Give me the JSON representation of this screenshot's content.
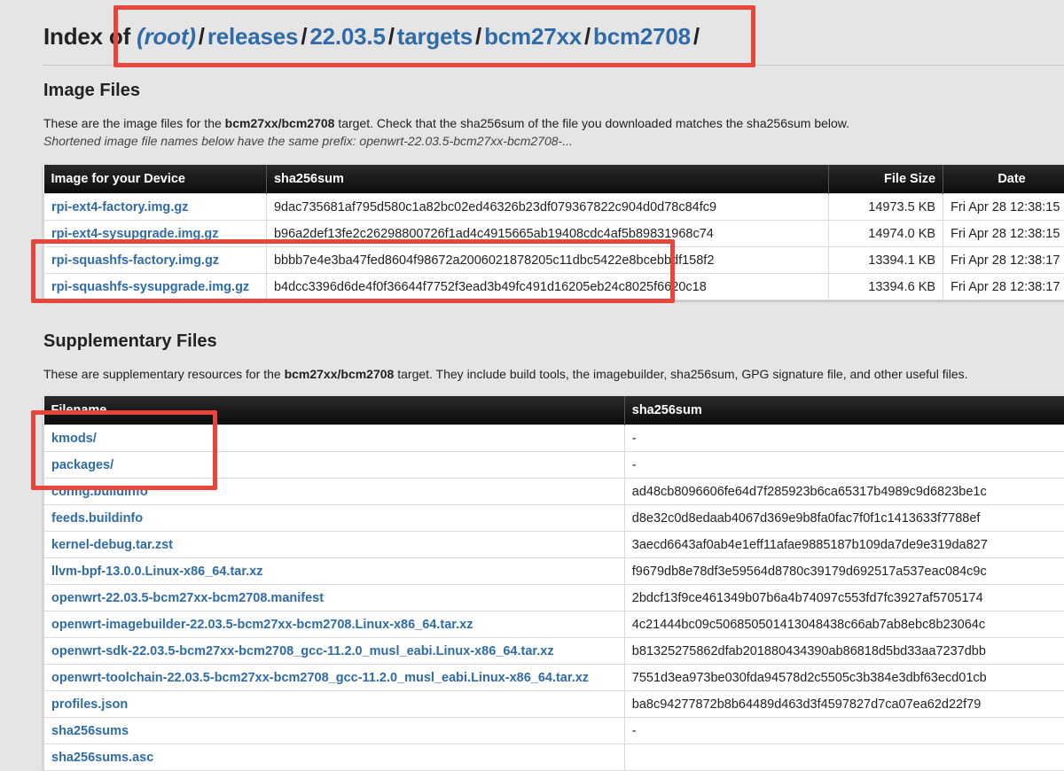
{
  "header": {
    "index_prefix": "Index of",
    "breadcrumbs": [
      "(root)",
      "releases",
      "22.03.5",
      "targets",
      "bcm27xx",
      "bcm2708"
    ],
    "separator": "/"
  },
  "image_files": {
    "title": "Image Files",
    "desc_prefix": "These are the image files for the ",
    "target": "bcm27xx/bcm2708",
    "desc_suffix": " target. Check that the sha256sum of the file you downloaded matches the sha256sum below.",
    "prefix_note": "Shortened image file names below have the same prefix: openwrt-22.03.5-bcm27xx-bcm2708-...",
    "columns": [
      "Image for your Device",
      "sha256sum",
      "File Size",
      "Date"
    ],
    "rows": [
      {
        "name": "rpi-ext4-factory.img.gz",
        "sha": "9dac735681af795d580c1a82bc02ed46326b23df079367822c904d0d78c84fc9",
        "size": "14973.5 KB",
        "date": "Fri Apr 28 12:38:15"
      },
      {
        "name": "rpi-ext4-sysupgrade.img.gz",
        "sha": "b96a2def13fe2c26298800726f1ad4c4915665ab19408cdc4af5b89831968c74",
        "size": "14974.0 KB",
        "date": "Fri Apr 28 12:38:15"
      },
      {
        "name": "rpi-squashfs-factory.img.gz",
        "sha": "bbbb7e4e3ba47fed8604f98672a2006021878205c11dbc5422e8bcebbdf158f2",
        "size": "13394.1 KB",
        "date": "Fri Apr 28 12:38:17"
      },
      {
        "name": "rpi-squashfs-sysupgrade.img.gz",
        "sha": "b4dcc3396d6de4f0f36644f7752f3ead3b49fc491d16205eb24c8025f6620c18",
        "size": "13394.6 KB",
        "date": "Fri Apr 28 12:38:17"
      }
    ]
  },
  "supplementary_files": {
    "title": "Supplementary Files",
    "desc_prefix": "These are supplementary resources for the ",
    "target": "bcm27xx/bcm2708",
    "desc_suffix": " target. They include build tools, the imagebuilder, sha256sum, GPG signature file, and other useful files.",
    "columns": [
      "Filename",
      "sha256sum"
    ],
    "rows": [
      {
        "name": "kmods/",
        "sha": "-"
      },
      {
        "name": "packages/",
        "sha": "-"
      },
      {
        "name": "config.buildinfo",
        "sha": "ad48cb8096606fe64d7f285923b6ca65317b4989c9d6823be1c"
      },
      {
        "name": "feeds.buildinfo",
        "sha": "d8e32c0d8edaab4067d369e9b8fa0fac7f0f1c1413633f7788ef"
      },
      {
        "name": "kernel-debug.tar.zst",
        "sha": "3aecd6643af0ab4e1eff11afae9885187b109da7de9e319da827"
      },
      {
        "name": "llvm-bpf-13.0.0.Linux-x86_64.tar.xz",
        "sha": "f9679db8e78df3e59564d8780c39179d692517a537eac084c9c"
      },
      {
        "name": "openwrt-22.03.5-bcm27xx-bcm2708.manifest",
        "sha": "2bdcf13f9ce461349b07b6a4b74097c553fd7fc3927af5705174"
      },
      {
        "name": "openwrt-imagebuilder-22.03.5-bcm27xx-bcm2708.Linux-x86_64.tar.xz",
        "sha": "4c21444bc09c506850501413048438c66ab7ab8ebc8b23064c"
      },
      {
        "name": "openwrt-sdk-22.03.5-bcm27xx-bcm2708_gcc-11.2.0_musl_eabi.Linux-x86_64.tar.xz",
        "sha": "b81325275862dfab201880434390ab86818d5bd33aa7237dbb"
      },
      {
        "name": "openwrt-toolchain-22.03.5-bcm27xx-bcm2708_gcc-11.2.0_musl_eabi.Linux-x86_64.tar.xz",
        "sha": "7551d3ea973be030fda94578d2c5505c3b384e3dbf63ecd01cb"
      },
      {
        "name": "profiles.json",
        "sha": "ba8c94277872b8b64489d463d3f4597827d7ca07ea62d22f79"
      },
      {
        "name": "sha256sums",
        "sha": "-"
      },
      {
        "name": "sha256sums.asc",
        "sha": ""
      }
    ]
  },
  "colors": {
    "highlight": "#e8453c",
    "link": "#2f6ba6",
    "header_bg": "#0c0c0c",
    "page_bg": "#e5e5e5"
  }
}
